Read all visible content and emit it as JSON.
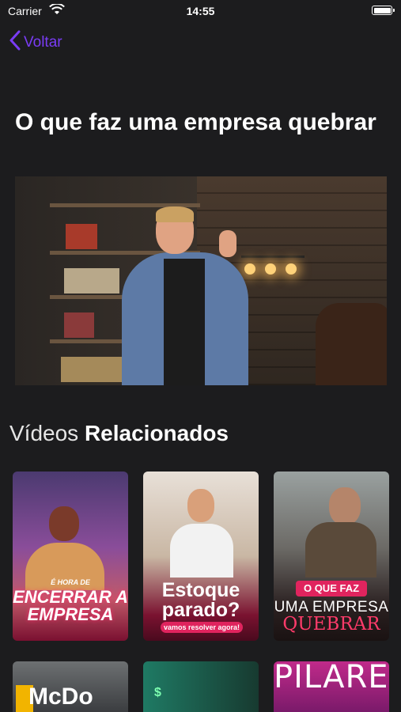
{
  "status_bar": {
    "carrier": "Carrier",
    "time": "14:55"
  },
  "nav": {
    "back_label": "Voltar"
  },
  "video": {
    "title": "O que faz uma empresa quebrar"
  },
  "related": {
    "title_light": "Vídeos",
    "title_bold": "Relacionados",
    "items": [
      {
        "line1": "É HORA DE",
        "line2": "ENCERRAR A EMPRESA"
      },
      {
        "line1": "Estoque",
        "line2": "parado?",
        "line3": "vamos resolver agora!"
      },
      {
        "line1": "O QUE FAZ",
        "line2": "UMA EMPRESA",
        "line3": "QUEBRAR"
      },
      {
        "line1": "McDo"
      },
      {
        "line1": "$"
      },
      {
        "line1": "PILARES"
      }
    ]
  },
  "colors": {
    "accent": "#7a3cf5",
    "background": "#1c1c1e"
  }
}
